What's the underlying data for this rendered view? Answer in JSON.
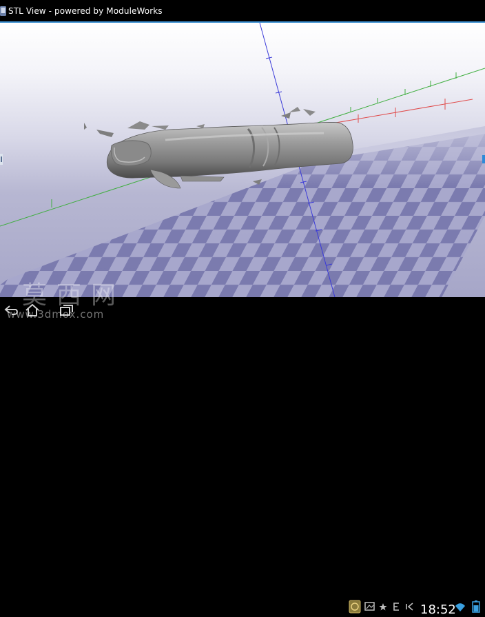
{
  "window": {
    "title": "STL View - powered by ModuleWorks"
  },
  "watermark": {
    "chinese": "莫西网",
    "url": "www.3dmox.com"
  },
  "status_bar": {
    "time": "18:52"
  },
  "axes": {
    "x_color": "#e04a4a",
    "y_color": "#3fae3f",
    "z_color": "#3a3ad8"
  },
  "icons": {
    "app": "app-icon",
    "back": "back-icon",
    "home": "home-icon",
    "recent": "recent-apps-icon",
    "tray": [
      "notification-app-icon",
      "image-icon",
      "star-icon",
      "e-icon",
      "usb-icon",
      "alarm-icon",
      "wifi-icon",
      "battery-icon"
    ]
  }
}
